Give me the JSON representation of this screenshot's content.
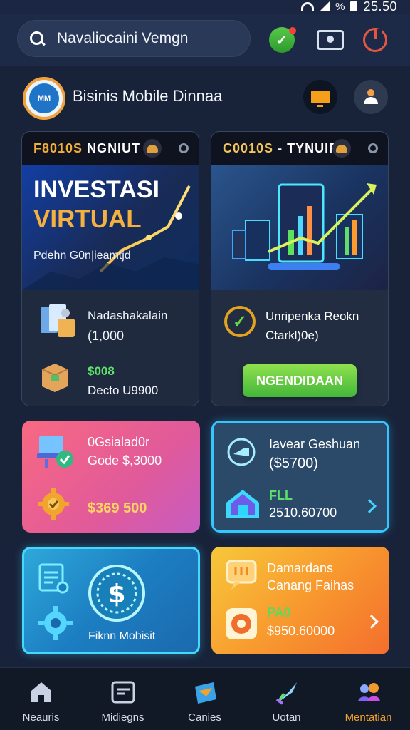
{
  "status": {
    "time": "25.50",
    "battery": "%"
  },
  "search": {
    "placeholder": "Navaliocaini Vemgn"
  },
  "header": {
    "title": "Bisinis Mobile Dinnaa",
    "logo_text": "MM"
  },
  "cards": {
    "investasi": {
      "top_label_a": "F8010S",
      "top_label_b": "NGNIUT",
      "title_line1": "INVESTASI",
      "title_line2": "VIRTUAL",
      "subtitle": "Pdehn G0n|ieamtjd",
      "item1_title": "Nadashakalain",
      "item1_value": "(1,000",
      "item2_value": "$008",
      "item2_title": "Decto U9900"
    },
    "statistik": {
      "top_label_a": "C0010S",
      "top_label_b": "TYNUIR8",
      "line1": "Unripenka Reokn",
      "line2": "Ctarkl)0e)",
      "button": "NGENDIDAAN"
    }
  },
  "tiles": {
    "pink": {
      "line1": "0Gsialad0r",
      "line2": "Gode $,3000",
      "line3": "$369 500"
    },
    "blue": {
      "line1": "Iavear Geshuan",
      "line2": "($5700)",
      "line3": "FLL",
      "line4": "2510.60700"
    },
    "cyan": {
      "label": "Fiknn Mobisit"
    },
    "orange": {
      "line1": "Damardans",
      "line2": "Canang Faihas",
      "line3": "PA0",
      "line4": "$950.60000"
    }
  },
  "bottom_nav": [
    {
      "label": "Neauris",
      "icon": "home-icon",
      "active": false
    },
    {
      "label": "Midiegns",
      "icon": "card-icon",
      "active": false
    },
    {
      "label": "Canies",
      "icon": "folder-icon",
      "active": false
    },
    {
      "label": "Uotan",
      "icon": "rocket-icon",
      "active": false
    },
    {
      "label": "Mentatian",
      "icon": "users-icon",
      "active": true
    }
  ],
  "colors": {
    "accent_orange": "#F5A12D",
    "accent_green": "#5EE26A",
    "accent_cyan": "#37C5FF"
  }
}
